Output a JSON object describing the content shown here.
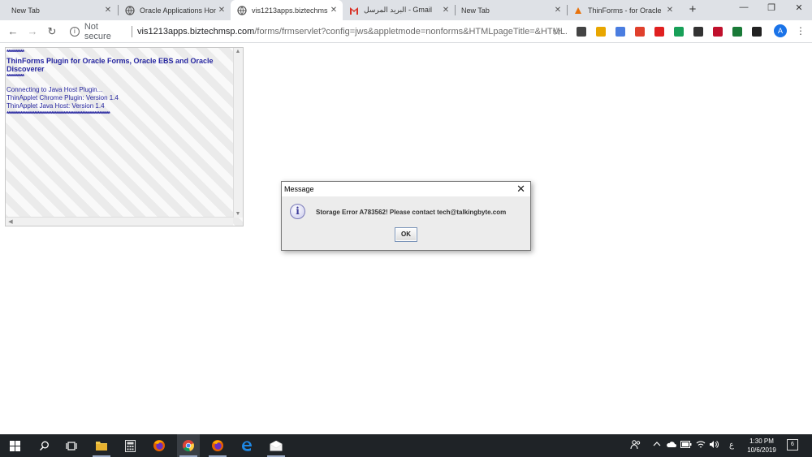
{
  "tabs": [
    {
      "title": "New Tab",
      "close": "✕"
    },
    {
      "title": "Oracle Applications Hom",
      "close": "✕"
    },
    {
      "title": "vis1213apps.biztechmsp",
      "close": "✕"
    },
    {
      "title": "البريد المرسل - Gmail",
      "close": "✕"
    },
    {
      "title": "New Tab",
      "close": "✕"
    },
    {
      "title": "ThinForms - for Oracle",
      "close": "✕"
    }
  ],
  "new_tab_label": "+",
  "window_controls": {
    "minimize": "—",
    "restore": "❐",
    "close": "✕"
  },
  "toolbar": {
    "back": "←",
    "forward": "→",
    "reload": "↻",
    "not_secure": "Not secure",
    "host": "vis1213apps.biztechmsp.com",
    "path": "/forms/frmservlet?config=jws&appletmode=nonforms&HTMLpageTitle=&HTML...",
    "star": "☆",
    "avatar_letter": "A",
    "menu": "⋮",
    "extension_colors": [
      "#444444",
      "#e8a600",
      "#4a7de0",
      "#e0402c",
      "#e02020",
      "#18a058",
      "#333333",
      "#c0102c",
      "#1a7a38",
      "#222222"
    ]
  },
  "applet": {
    "stars_short": "**********",
    "heading": "ThinForms Plugin for Oracle Forms, Oracle EBS and Oracle Discoverer",
    "stars_short2": "**********",
    "line1": "Connecting to Java Host Plugin...",
    "line2": "ThinApplet Chrome Plugin: Version 1.4",
    "line3": "ThinApplet Java Host: Version 1.4",
    "stars_long": "************************************************************"
  },
  "dialog": {
    "title": "Message",
    "close": "✕",
    "icon": "i",
    "message": "Storage Error A783562! Please contact tech@talkingbyte.com",
    "ok_label": "OK"
  },
  "taskbar": {
    "clock_time": "1:30 PM",
    "clock_date": "10/6/2019",
    "lang": "ع",
    "notification_count": "6",
    "icons": [
      "windows-start-icon",
      "search-icon",
      "task-view-icon",
      "file-explorer-icon",
      "calculator-icon",
      "firefox-icon",
      "chrome-icon",
      "firefox-icon-2",
      "edge-icon",
      "mail-icon"
    ]
  }
}
